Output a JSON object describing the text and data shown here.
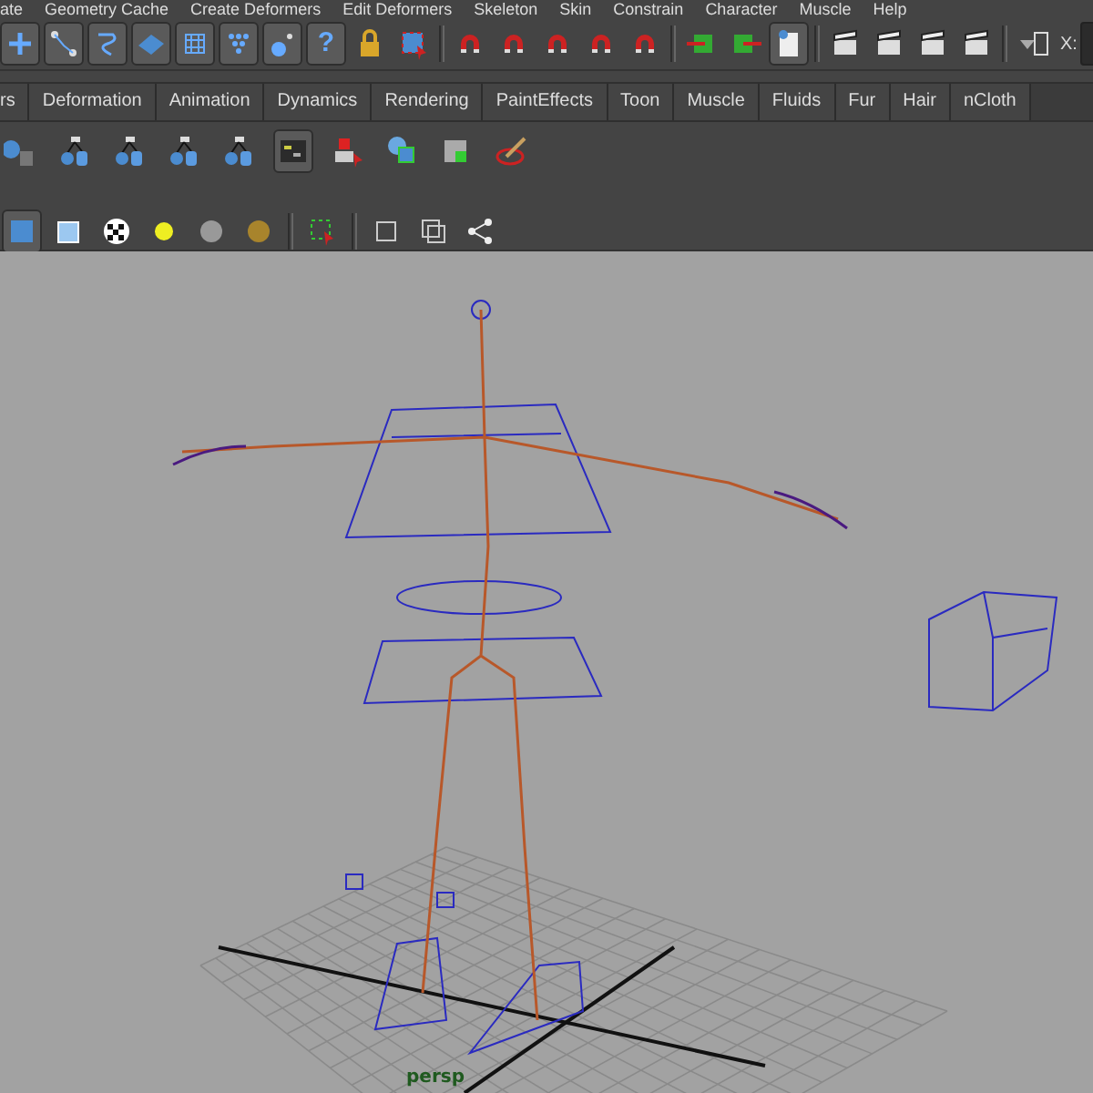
{
  "menu_bar": [
    "ate",
    "Geometry Cache",
    "Create Deformers",
    "Edit Deformers",
    "Skeleton",
    "Skin",
    "Constrain",
    "Character",
    "Muscle",
    "Help"
  ],
  "status_line": {
    "help_glyph": "?",
    "coordinate_label": "X:"
  },
  "shelf_tabs": [
    {
      "label": "rs",
      "selected": false
    },
    {
      "label": "Deformation",
      "selected": false
    },
    {
      "label": "Animation",
      "selected": false
    },
    {
      "label": "Dynamics",
      "selected": false
    },
    {
      "label": "Rendering",
      "selected": false
    },
    {
      "label": "PaintEffects",
      "selected": false
    },
    {
      "label": "Toon",
      "selected": false
    },
    {
      "label": "Muscle",
      "selected": false
    },
    {
      "label": "Fluids",
      "selected": false
    },
    {
      "label": "Fur",
      "selected": false
    },
    {
      "label": "Hair",
      "selected": false
    },
    {
      "label": "nCloth",
      "selected": false
    }
  ],
  "viewport": {
    "camera_label": "persp"
  }
}
